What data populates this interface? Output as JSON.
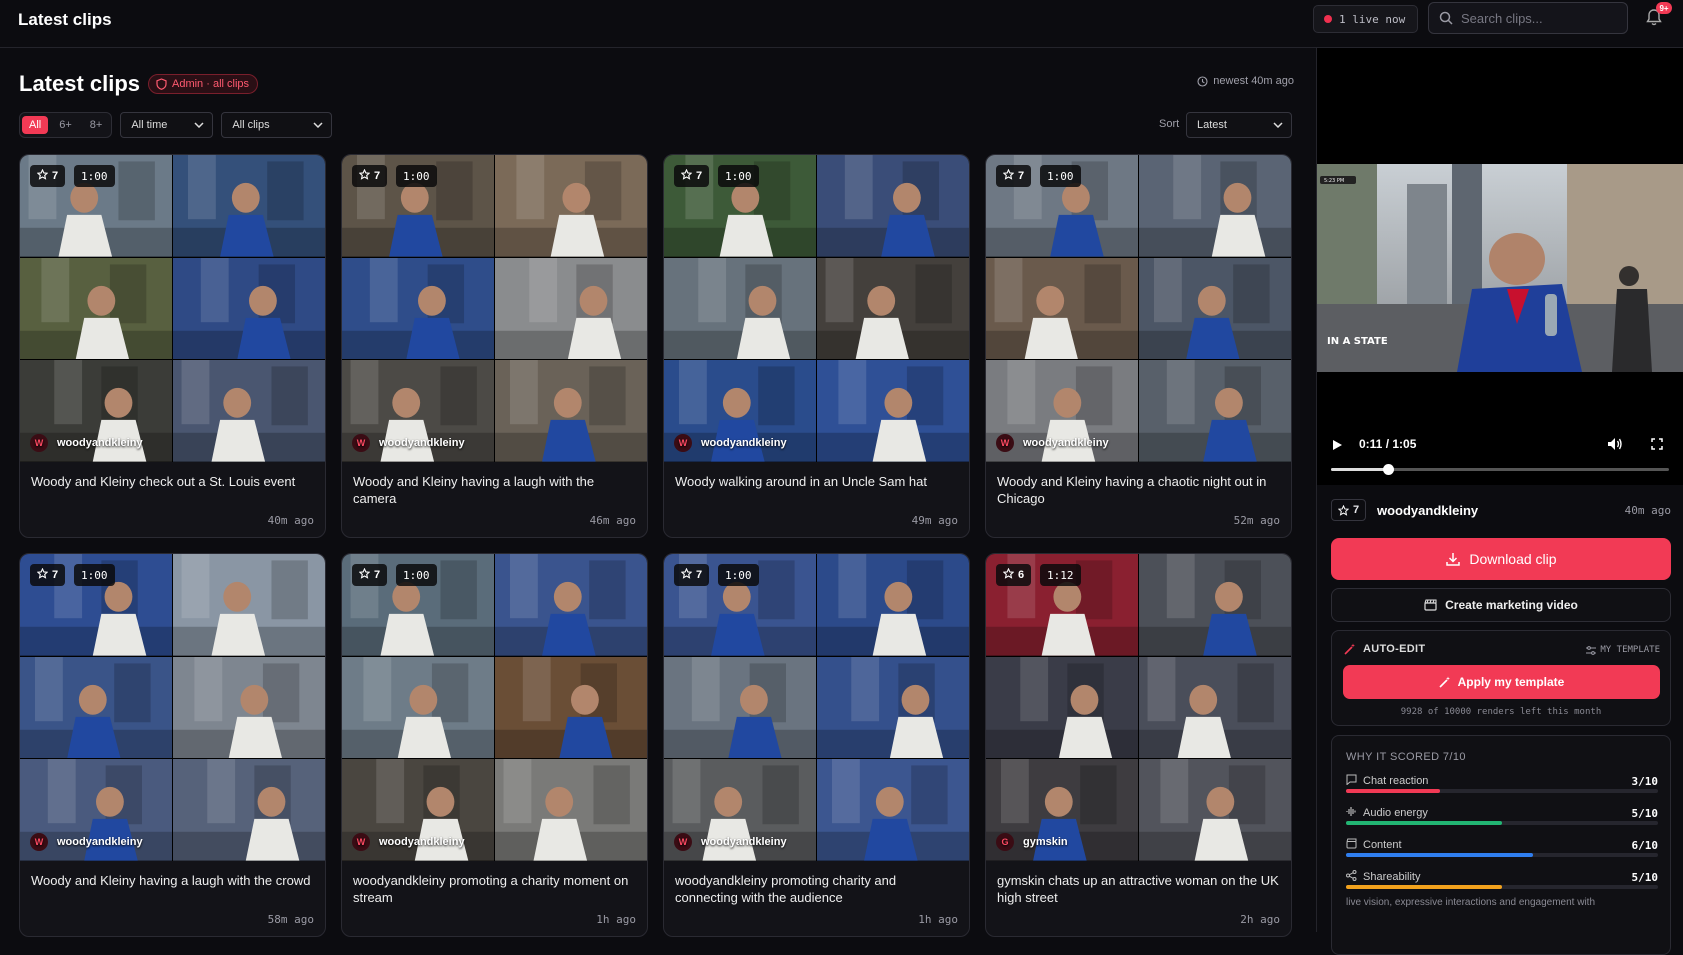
{
  "topbar": {
    "title": "Latest clips",
    "live_label": "1 live now",
    "search_placeholder": "Search clips...",
    "notif_badge": "9+"
  },
  "main": {
    "title": "Latest clips",
    "admin_badge": "Admin · all clips",
    "newest": "newest 40m ago",
    "score_tabs": [
      "All",
      "6+",
      "8+"
    ],
    "time_filter": "All time",
    "clip_filter": "All clips",
    "sort_label": "Sort",
    "sort_value": "Latest"
  },
  "clips": [
    {
      "score": "7",
      "duration": "1:00",
      "channel": "woodyandkleiny",
      "avatar": "W",
      "title": "Woody and Kleiny check out a St. Louis event",
      "ago": "40m ago",
      "palette": [
        "#6b7a88",
        "#34507a",
        "#586040",
        "#2f4a85",
        "#3b3c38",
        "#4a5670"
      ]
    },
    {
      "score": "7",
      "duration": "1:00",
      "channel": "woodyandkleiny",
      "avatar": "W",
      "title": "Woody and Kleiny having a laugh with the camera",
      "ago": "46m ago",
      "palette": [
        "#5d5448",
        "#7b6a58",
        "#2f4d8a",
        "#8a8c8e",
        "#4c4a46",
        "#6a6258"
      ]
    },
    {
      "score": "7",
      "duration": "1:00",
      "channel": "woodyandkleiny",
      "avatar": "W",
      "title": "Woody walking around in an Uncle Sam hat",
      "ago": "49m ago",
      "palette": [
        "#3d5a38",
        "#3a4d78",
        "#67727c",
        "#44403c",
        "#2a4c8c",
        "#2f5096"
      ]
    },
    {
      "score": "7",
      "duration": "1:00",
      "channel": "woodyandkleiny",
      "avatar": "W",
      "title": "Woody and Kleiny having a chaotic night out in Chicago",
      "ago": "52m ago",
      "palette": [
        "#6e7884",
        "#5a6474",
        "#6a5a4c",
        "#4c5666",
        "#7a7c80",
        "#58606a"
      ]
    },
    {
      "score": "7",
      "duration": "1:00",
      "channel": "woodyandkleiny",
      "avatar": "W",
      "title": "Woody and Kleiny having a laugh with the crowd",
      "ago": "58m ago",
      "palette": [
        "#2e4d92",
        "#8a96a4",
        "#3a5488",
        "#7e8690",
        "#4a5a7e",
        "#56627a"
      ]
    },
    {
      "score": "7",
      "duration": "1:00",
      "channel": "woodyandkleiny",
      "avatar": "W",
      "title": "woodyandkleiny promoting a charity moment on stream",
      "ago": "1h ago",
      "palette": [
        "#5a6c7a",
        "#3a548e",
        "#6e7c88",
        "#6a4e36",
        "#4a4640",
        "#7a7a78"
      ]
    },
    {
      "score": "7",
      "duration": "1:00",
      "channel": "woodyandkleiny",
      "avatar": "W",
      "title": "woodyandkleiny promoting charity and connecting with the audience",
      "ago": "1h ago",
      "palette": [
        "#3a5490",
        "#2c4a8a",
        "#6a7480",
        "#34508c",
        "#5a5c5e",
        "#3c5690"
      ]
    },
    {
      "score": "6",
      "duration": "1:12",
      "channel": "gymskin",
      "avatar": "G",
      "title": "gymskin chats up an attractive woman on the UK high street",
      "ago": "2h ago",
      "palette": [
        "#8a2030",
        "#4c5058",
        "#3a3c48",
        "#4a4e5a",
        "#3e3c40",
        "#52545c"
      ]
    }
  ],
  "player": {
    "time": "0:11 / 1:05",
    "progress": 0.17,
    "score": "7",
    "channel": "woodyandkleiny",
    "ago": "40m ago",
    "watermark": "IN A STATE",
    "stamp": "5:23 PM"
  },
  "actions": {
    "download": "Download clip",
    "marketing": "Create marketing video"
  },
  "autoedit": {
    "title": "AUTO-EDIT",
    "template_label": "MY TEMPLATE",
    "apply": "Apply my template",
    "renders_left": "9928 of 10000 renders left this month"
  },
  "why": {
    "title": "WHY IT SCORED 7/10",
    "rows": [
      {
        "label": "Chat reaction",
        "value": "3/10",
        "fraction": 0.3,
        "color": "#f23a55",
        "icon": "chat-icon"
      },
      {
        "label": "Audio energy",
        "value": "5/10",
        "fraction": 0.5,
        "color": "#22b573",
        "icon": "waveform-icon"
      },
      {
        "label": "Content",
        "value": "6/10",
        "fraction": 0.6,
        "color": "#2f7ef0",
        "icon": "clapper-icon"
      },
      {
        "label": "Shareability",
        "value": "5/10",
        "fraction": 0.5,
        "color": "#f2a21d",
        "icon": "share-icon"
      }
    ],
    "summary": "live vision, expressive interactions and engagement with"
  }
}
